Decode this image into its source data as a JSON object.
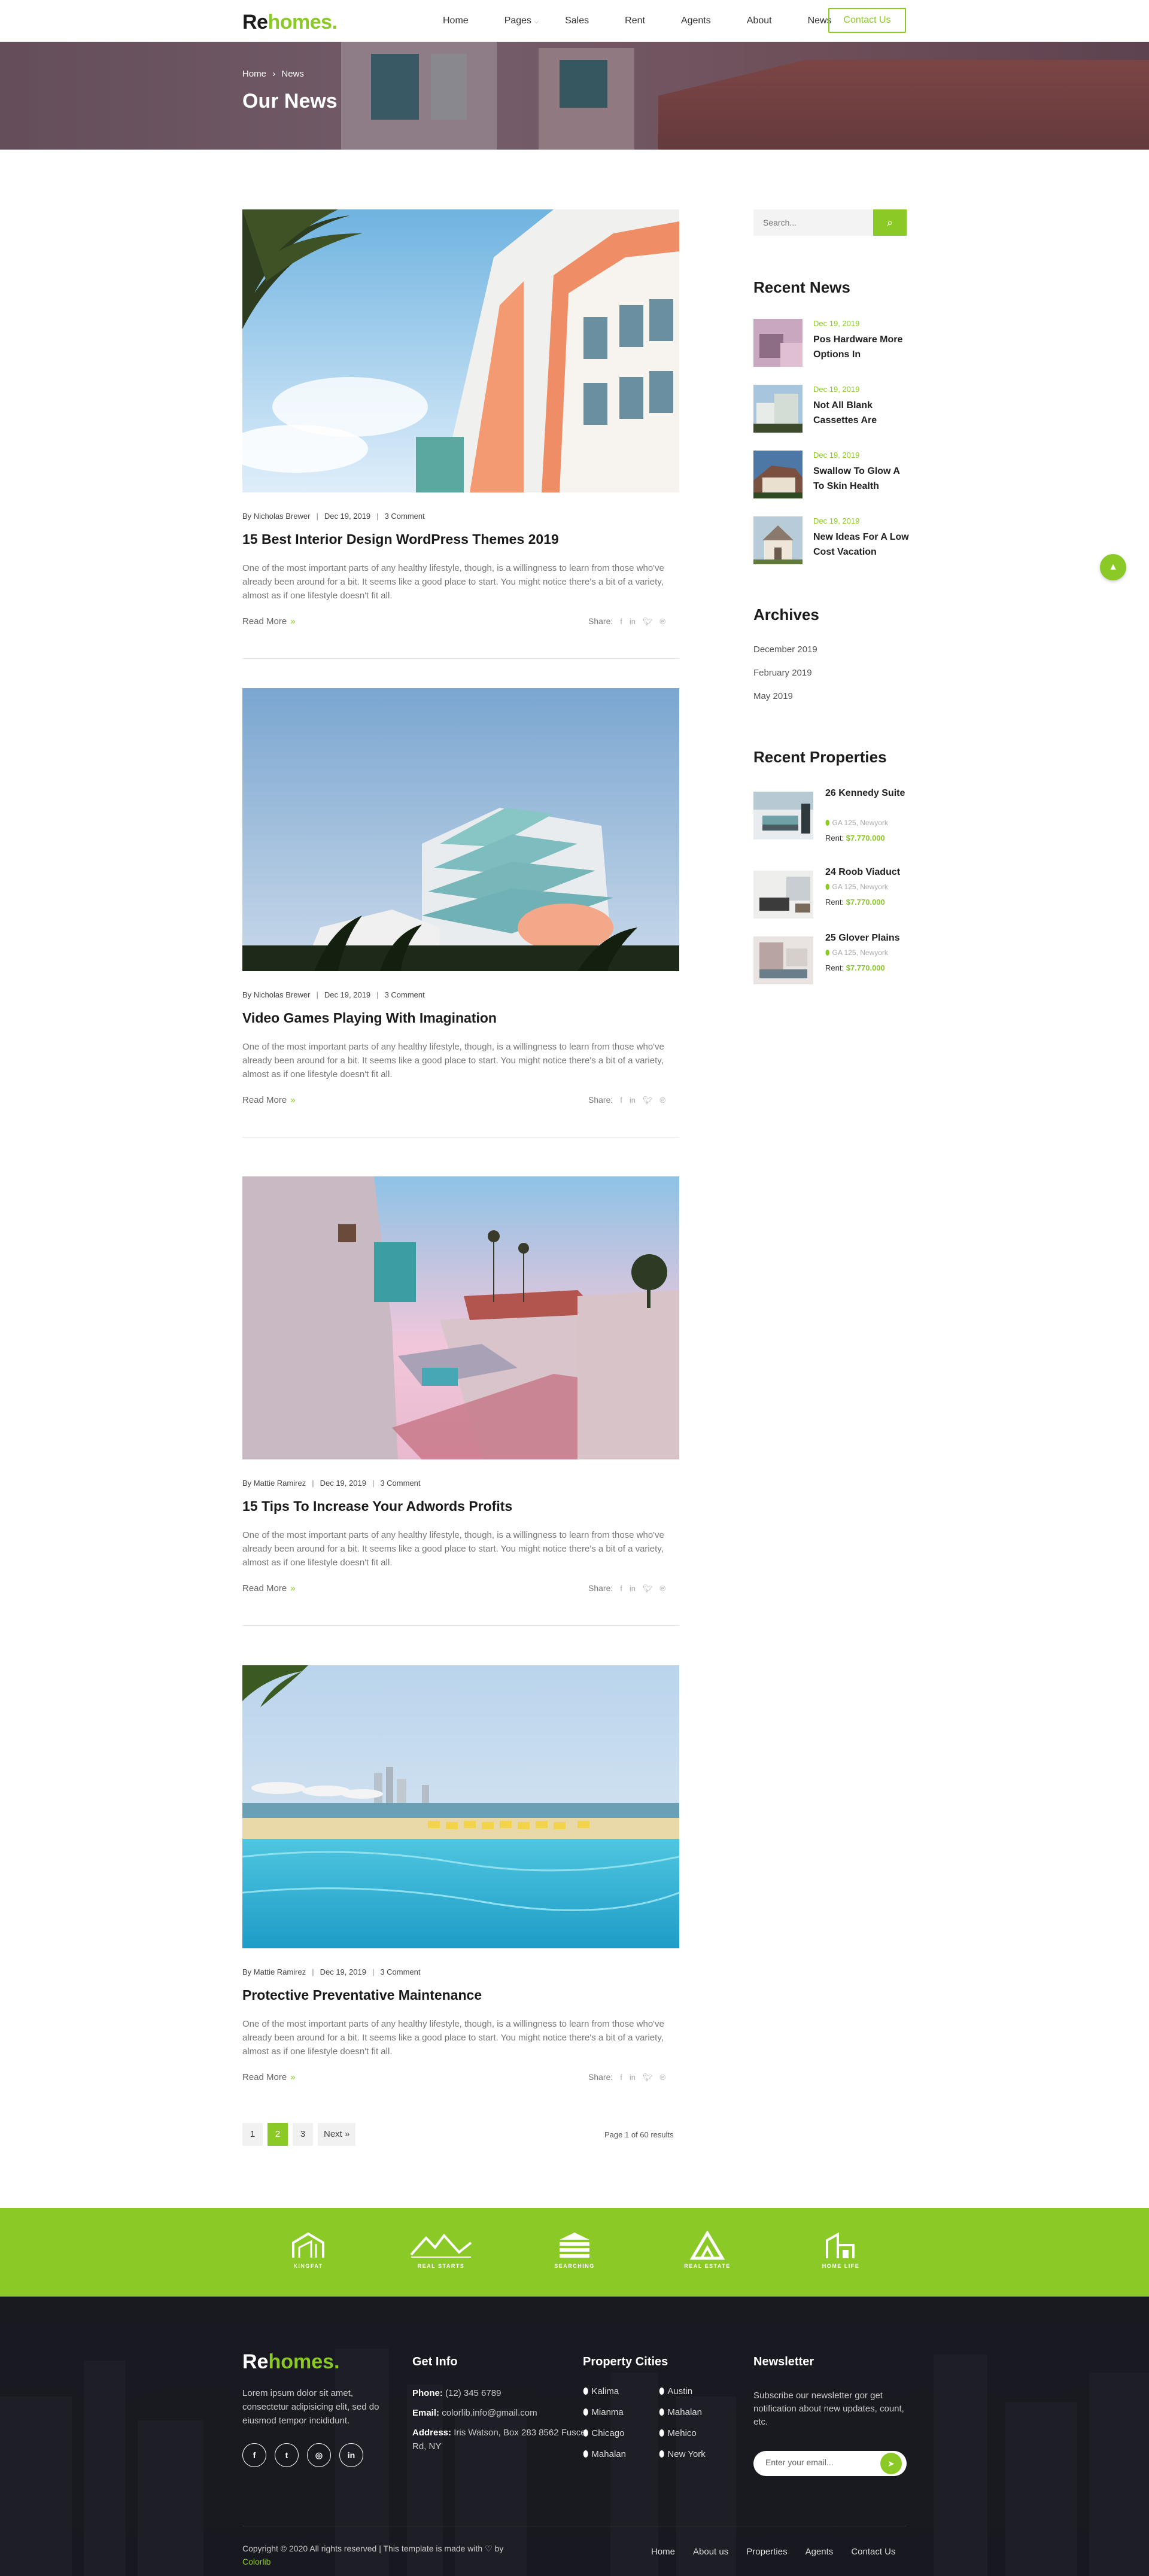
{
  "header": {
    "logo_re": "Re",
    "logo_homes": "homes.",
    "nav": [
      "Home",
      "Pages",
      "Sales",
      "Rent",
      "Agents",
      "About",
      "News"
    ],
    "nav_dropdown_icon": "chevron-down-icon",
    "contact_label": "Contact Us"
  },
  "hero": {
    "breadcrumb_home": "Home",
    "breadcrumb_sep": "›",
    "breadcrumb_current": "News",
    "title": "Our News"
  },
  "posts": [
    {
      "author": "By Nicholas Brewer",
      "date": "Dec 19, 2019",
      "comments": "3 Comment",
      "title": "15 Best Interior Design WordPress Themes 2019",
      "excerpt": "One of the most important parts of any healthy lifestyle, though, is a willingness to learn from those who've already been around for a bit. It seems like a good place to start. You might notice there's a bit of a variety, almost as if one lifestyle doesn't fit all.",
      "read_more": "Read More",
      "share": "Share:"
    },
    {
      "author": "By Nicholas Brewer",
      "date": "Dec 19, 2019",
      "comments": "3 Comment",
      "title": "Video Games Playing With Imagination",
      "excerpt": "One of the most important parts of any healthy lifestyle, though, is a willingness to learn from those who've already been around for a bit. It seems like a good place to start. You might notice there's a bit of a variety, almost as if one lifestyle doesn't fit all.",
      "read_more": "Read More",
      "share": "Share:"
    },
    {
      "author": "By Mattie Ramirez",
      "date": "Dec 19, 2019",
      "comments": "3 Comment",
      "title": "15 Tips To Increase Your Adwords Profits",
      "excerpt": "One of the most important parts of any healthy lifestyle, though, is a willingness to learn from those who've already been around for a bit. It seems like a good place to start. You might notice there's a bit of a variety, almost as if one lifestyle doesn't fit all.",
      "read_more": "Read More",
      "share": "Share:"
    },
    {
      "author": "By Mattie Ramirez",
      "date": "Dec 19, 2019",
      "comments": "3 Comment",
      "title": "Protective Preventative Maintenance",
      "excerpt": "One of the most important parts of any healthy lifestyle, though, is a willingness to learn from those who've already been around for a bit. It seems like a good place to start. You might notice there's a bit of a variety, almost as if one lifestyle doesn't fit all.",
      "read_more": "Read More",
      "share": "Share:"
    }
  ],
  "share_icons": [
    "facebook-icon",
    "linkedin-icon",
    "twitter-icon",
    "pinterest-icon"
  ],
  "pagination": {
    "pages": [
      "1",
      "2",
      "3"
    ],
    "current": "2",
    "next": "Next »",
    "info": "Page 1 of 60 results"
  },
  "sidebar": {
    "search_placeholder": "Search...",
    "recent_news_title": "Recent News",
    "recent_news": [
      {
        "date": "Dec 19, 2019",
        "title": "Pos Hardware More Options In"
      },
      {
        "date": "Dec 19, 2019",
        "title": "Not All Blank Cassettes Are"
      },
      {
        "date": "Dec 19, 2019",
        "title": "Swallow To Glow A To Skin Health"
      },
      {
        "date": "Dec 19, 2019",
        "title": "New Ideas For A Low Cost Vacation"
      }
    ],
    "archives_title": "Archives",
    "archives": [
      "December 2019",
      "February 2019",
      "May 2019"
    ],
    "recent_properties_title": "Recent Properties",
    "recent_properties": [
      {
        "title": "26 Kennedy Suite",
        "location": "GA 125, Newyork",
        "rent_label": "Rent:",
        "rent": "$7.770.000"
      },
      {
        "title": "24 Roob Viaduct",
        "location": "GA 125, Newyork",
        "rent_label": "Rent:",
        "rent": "$7.770.000"
      },
      {
        "title": "25 Glover Plains",
        "location": "GA 125, Newyork",
        "rent_label": "Rent:",
        "rent": "$7.770.000"
      }
    ]
  },
  "partners": [
    "KINGFAT",
    "REAL STARTS",
    "SEARCHING",
    "REAL ESTATE",
    "HOME LIFE"
  ],
  "footer": {
    "logo_re": "Re",
    "logo_homes": "homes.",
    "about": "Lorem ipsum dolor sit amet, consectetur adipisicing elit, sed do eiusmod tempor incididunt.",
    "social": [
      "f",
      "t",
      "◎",
      "in"
    ],
    "get_info_title": "Get Info",
    "phone_label": "Phone:",
    "phone": "(12) 345 6789",
    "email_label": "Email:",
    "email": "colorlib.info@gmail.com",
    "address_label": "Address:",
    "address": "Iris Watson, Box 283 8562 Fusce Rd, NY",
    "cities_title": "Property Cities",
    "cities_col1": [
      "Kalima",
      "Mianma",
      "Chicago",
      "Mahalan"
    ],
    "cities_col2": [
      "Austin",
      "Mahalan",
      "Mehico",
      "New York"
    ],
    "newsletter_title": "Newsletter",
    "newsletter_text": "Subscribe our newsletter gor get notification about new updates, count, etc.",
    "newsletter_placeholder": "Enter your email...",
    "copyright": "Copyright © 2020 All rights reserved | This template is made with ♡ by",
    "copyright_link": "Colorlib",
    "nav": [
      "Home",
      "About us",
      "Properties",
      "Agents",
      "Contact Us"
    ]
  },
  "colors": {
    "accent": "#8ac926",
    "footer_bg": "#1f1f26"
  }
}
